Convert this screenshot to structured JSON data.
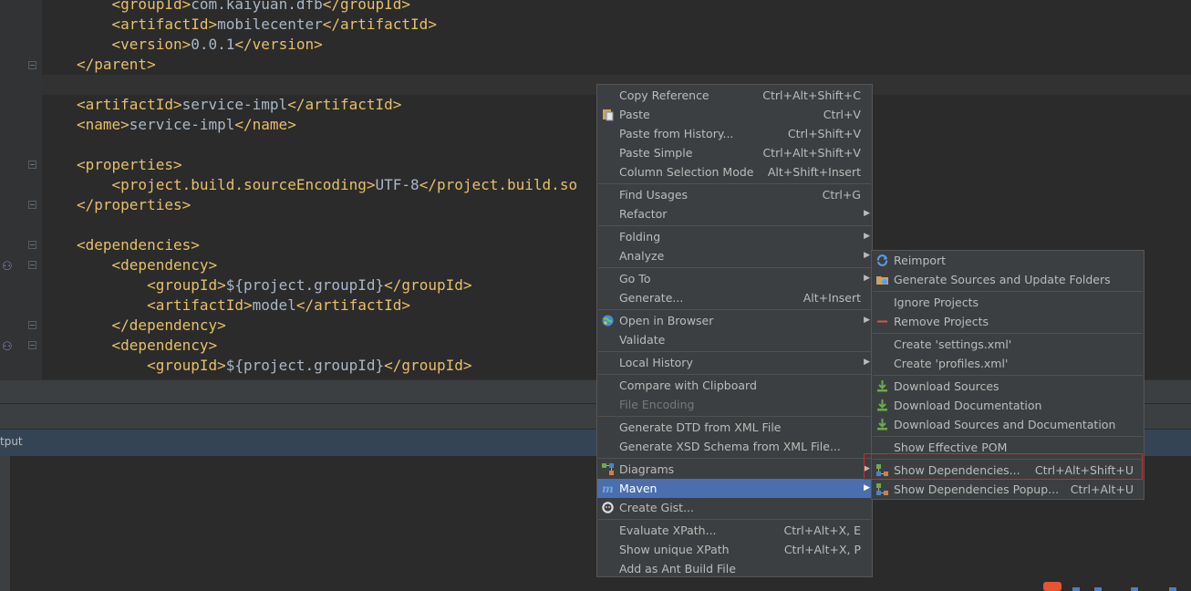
{
  "editor": {
    "lines": [
      {
        "segments": [
          {
            "t": "    "
          },
          {
            "t": "<groupId>",
            "c": "tag"
          },
          {
            "t": "com.kaiyuan.dfb",
            "c": "txt"
          },
          {
            "t": "</groupId>",
            "c": "tag"
          }
        ]
      },
      {
        "segments": [
          {
            "t": "    "
          },
          {
            "t": "<artifactId>",
            "c": "tag"
          },
          {
            "t": "mobilecenter",
            "c": "txt"
          },
          {
            "t": "</artifactId>",
            "c": "tag"
          }
        ]
      },
      {
        "segments": [
          {
            "t": "    "
          },
          {
            "t": "<version>",
            "c": "tag"
          },
          {
            "t": "0.0.1",
            "c": "txt"
          },
          {
            "t": "</version>",
            "c": "tag"
          }
        ]
      },
      {
        "segments": [
          {
            "t": "</parent>",
            "c": "tag"
          }
        ]
      },
      {
        "segments": [
          {
            "t": ""
          }
        ]
      },
      {
        "segments": [
          {
            "t": "<artifactId>",
            "c": "tag"
          },
          {
            "t": "service-impl",
            "c": "txt"
          },
          {
            "t": "</artifactId>",
            "c": "tag"
          }
        ]
      },
      {
        "segments": [
          {
            "t": "<name>",
            "c": "tag"
          },
          {
            "t": "service-impl",
            "c": "txt"
          },
          {
            "t": "</name>",
            "c": "tag"
          }
        ]
      },
      {
        "segments": [
          {
            "t": ""
          }
        ]
      },
      {
        "segments": [
          {
            "t": "<properties>",
            "c": "tag"
          }
        ]
      },
      {
        "segments": [
          {
            "t": "    "
          },
          {
            "t": "<project.build.sourceEncoding>",
            "c": "tag"
          },
          {
            "t": "UTF-8",
            "c": "txt"
          },
          {
            "t": "</project.build.so",
            "c": "tag"
          }
        ]
      },
      {
        "segments": [
          {
            "t": "</properties>",
            "c": "tag"
          }
        ]
      },
      {
        "segments": [
          {
            "t": ""
          }
        ]
      },
      {
        "segments": [
          {
            "t": "<dependencies>",
            "c": "tag"
          }
        ]
      },
      {
        "segments": [
          {
            "t": "    "
          },
          {
            "t": "<dependency>",
            "c": "tag"
          }
        ]
      },
      {
        "segments": [
          {
            "t": "        "
          },
          {
            "t": "<groupId>",
            "c": "tag"
          },
          {
            "t": "${project.groupId}",
            "c": "txt"
          },
          {
            "t": "</groupId>",
            "c": "tag"
          }
        ]
      },
      {
        "segments": [
          {
            "t": "        "
          },
          {
            "t": "<artifactId>",
            "c": "tag"
          },
          {
            "t": "model",
            "c": "txt"
          },
          {
            "t": "</artifactId>",
            "c": "tag"
          }
        ]
      },
      {
        "segments": [
          {
            "t": "    "
          },
          {
            "t": "</dependency>",
            "c": "tag"
          }
        ]
      },
      {
        "segments": [
          {
            "t": "    "
          },
          {
            "t": "<dependency>",
            "c": "tag"
          }
        ]
      },
      {
        "segments": [
          {
            "t": "        "
          },
          {
            "t": "<groupId>",
            "c": "tag"
          },
          {
            "t": "${project.groupId}",
            "c": "txt"
          },
          {
            "t": "</groupId>",
            "c": "tag"
          }
        ]
      }
    ]
  },
  "tool_window": {
    "title": "tput"
  },
  "context_menu": {
    "groups": [
      [
        {
          "label": "Copy Reference",
          "shortcut": "Ctrl+Alt+Shift+C"
        },
        {
          "label": "Paste",
          "shortcut": "Ctrl+V",
          "icon": "paste-icon"
        },
        {
          "label": "Paste from History...",
          "shortcut": "Ctrl+Shift+V"
        },
        {
          "label": "Paste Simple",
          "shortcut": "Ctrl+Alt+Shift+V"
        },
        {
          "label": "Column Selection Mode",
          "shortcut": "Alt+Shift+Insert"
        }
      ],
      [
        {
          "label": "Find Usages",
          "shortcut": "Ctrl+G"
        },
        {
          "label": "Refactor",
          "submenu": true
        }
      ],
      [
        {
          "label": "Folding",
          "submenu": true
        },
        {
          "label": "Analyze",
          "submenu": true
        }
      ],
      [
        {
          "label": "Go To",
          "submenu": true
        },
        {
          "label": "Generate...",
          "shortcut": "Alt+Insert"
        }
      ],
      [
        {
          "label": "Open in Browser",
          "submenu": true,
          "icon": "globe-icon"
        },
        {
          "label": "Validate"
        }
      ],
      [
        {
          "label": "Local History",
          "submenu": true
        }
      ],
      [
        {
          "label": "Compare with Clipboard"
        },
        {
          "label": "File Encoding",
          "disabled": true
        }
      ],
      [
        {
          "label": "Generate DTD from XML File"
        },
        {
          "label": "Generate XSD Schema from XML File..."
        }
      ],
      [
        {
          "label": "Diagrams",
          "submenu": true,
          "icon": "diagram-icon"
        },
        {
          "label": "Maven",
          "submenu": true,
          "icon": "maven-icon",
          "highlighted": true
        },
        {
          "label": "Create Gist...",
          "icon": "github-icon"
        }
      ],
      [
        {
          "label": "Evaluate XPath...",
          "shortcut": "Ctrl+Alt+X, E"
        },
        {
          "label": "Show unique XPath",
          "shortcut": "Ctrl+Alt+X, P"
        },
        {
          "label": "Add as Ant Build File"
        }
      ]
    ]
  },
  "maven_submenu": {
    "groups": [
      [
        {
          "label": "Reimport",
          "icon": "reimport-icon"
        },
        {
          "label": "Generate Sources and Update Folders",
          "icon": "generate-sources-icon"
        }
      ],
      [
        {
          "label": "Ignore Projects"
        },
        {
          "label": "Remove Projects",
          "icon": "remove-icon"
        }
      ],
      [
        {
          "label": "Create 'settings.xml'"
        },
        {
          "label": "Create 'profiles.xml'"
        }
      ],
      [
        {
          "label": "Download Sources",
          "icon": "download-icon"
        },
        {
          "label": "Download Documentation",
          "icon": "download-icon"
        },
        {
          "label": "Download Sources and Documentation",
          "icon": "download-icon"
        }
      ],
      [
        {
          "label": "Show Effective POM"
        }
      ],
      [
        {
          "label": "Show Dependencies...",
          "shortcut": "Ctrl+Alt+Shift+U",
          "icon": "dependencies-icon",
          "outlined": true
        },
        {
          "label": "Show Dependencies Popup...",
          "shortcut": "Ctrl+Alt+U",
          "icon": "dependencies-icon"
        }
      ]
    ]
  },
  "colors": {
    "accent": "#4b6eaf",
    "menu_bg": "#3c3f41",
    "tag": "#e8bf6a",
    "text": "#a9b7c6",
    "outline": "#cc2b2b"
  }
}
